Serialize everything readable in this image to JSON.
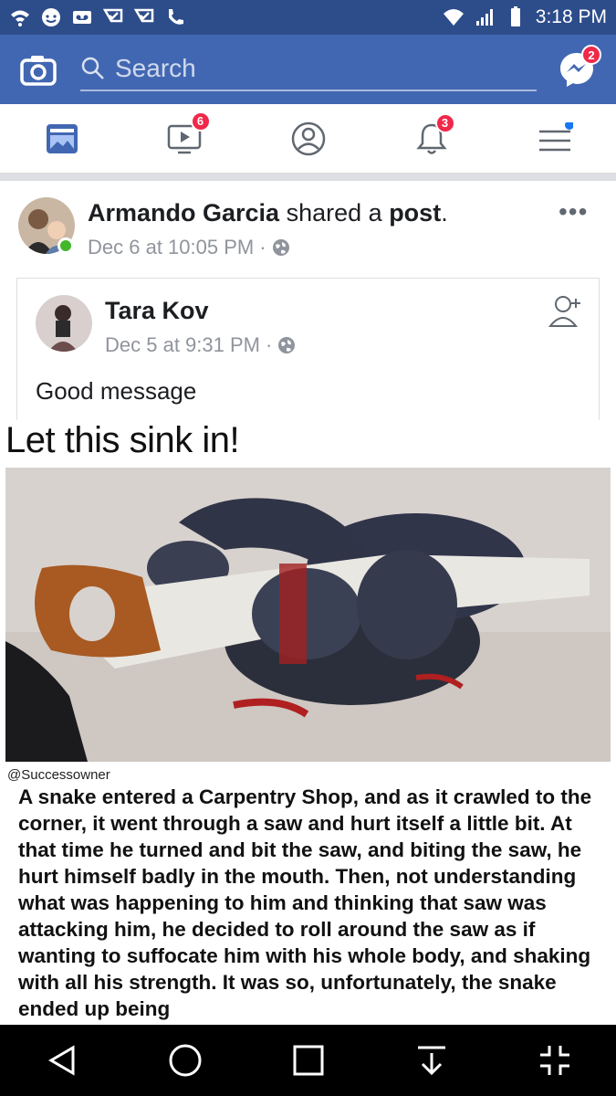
{
  "status_bar": {
    "time": "3:18 PM",
    "left_icons": [
      "wifi-calling-icon",
      "messenger-notif-icon",
      "voicemail-icon",
      "check-icon",
      "check-icon",
      "wifi-call-icon"
    ],
    "right_icons": [
      "wifi-icon",
      "signal-icon",
      "battery-icon"
    ]
  },
  "header": {
    "search_placeholder": "Search",
    "messenger_badge": "2",
    "brand_color": "#4267b2"
  },
  "tabs": [
    {
      "name": "news-feed",
      "icon": "news-feed-icon",
      "badge": ""
    },
    {
      "name": "watch",
      "icon": "video-icon",
      "badge": "6"
    },
    {
      "name": "profile",
      "icon": "profile-icon",
      "badge": ""
    },
    {
      "name": "notifications",
      "icon": "bell-icon",
      "badge": "3"
    },
    {
      "name": "menu",
      "icon": "menu-icon",
      "badge": ""
    }
  ],
  "post": {
    "author": "Armando Garcia",
    "action_prefix": "shared a",
    "action_object": "post",
    "action_suffix": ".",
    "timestamp": "Dec 6 at 10:05 PM",
    "separator": "·",
    "more": "•••",
    "shared": {
      "author": "Tara Kov",
      "timestamp": "Dec 5 at 9:31 PM",
      "separator": "·",
      "text": "Good message"
    }
  },
  "meme": {
    "title": "Let this sink in!",
    "credit": "@Successowner",
    "body": "A snake entered a Carpentry Shop, and as it crawled to the corner, it went through a saw and hurt itself a little bit. At that time he turned and bit the saw, and biting the saw, he hurt himself badly in the mouth. Then, not understanding what was happening to him and thinking that saw was attacking him, he decided to roll around the saw as if wanting to suffocate him with his whole body, and shaking with all his strength. It was so, unfortunately, the snake ended up being"
  },
  "nav": {
    "buttons": [
      "back-icon",
      "home-icon",
      "recents-icon",
      "download-icon",
      "collapse-icon"
    ]
  }
}
